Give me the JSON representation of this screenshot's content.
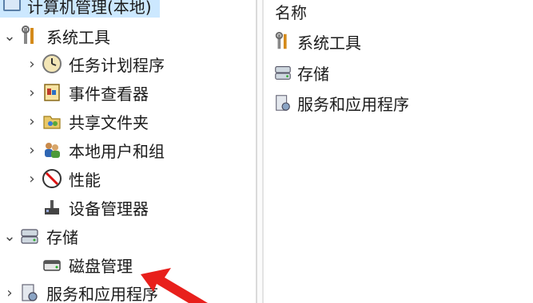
{
  "tree": {
    "root_label": "计算机管理(本地)",
    "system_tools": "系统工具",
    "task_scheduler": "任务计划程序",
    "event_viewer": "事件查看器",
    "shared_folders": "共享文件夹",
    "local_users": "本地用户和组",
    "performance": "性能",
    "device_manager": "设备管理器",
    "storage": "存储",
    "disk_management": "磁盘管理",
    "services_apps": "服务和应用程序"
  },
  "list": {
    "column_name": "名称",
    "items": [
      "系统工具",
      "存储",
      "服务和应用程序"
    ]
  },
  "annotation": {
    "arrow_color": "#e8201c"
  }
}
